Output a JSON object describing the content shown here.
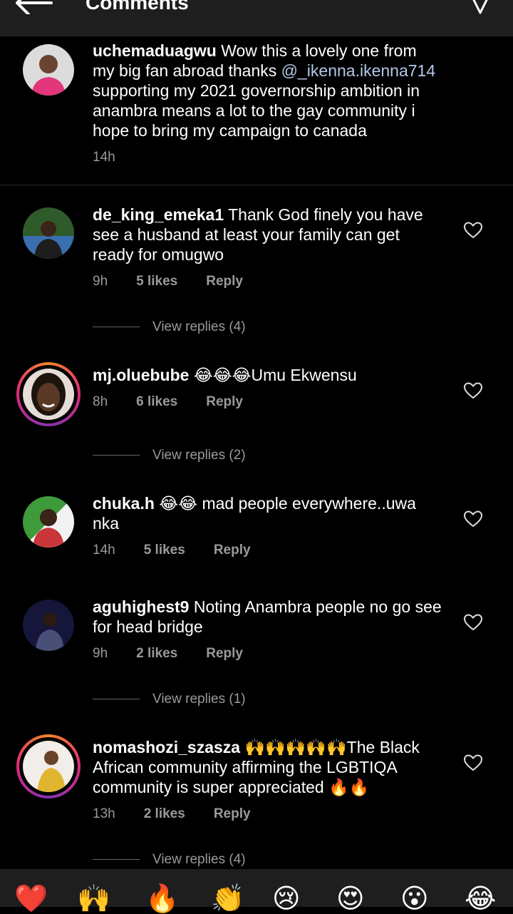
{
  "header": {
    "title": "Comments",
    "back_icon": "back-arrow-icon",
    "send_icon": "send-icon"
  },
  "caption": {
    "username": "uchemaduagwu",
    "text_before": " Wow this a lovely one from my big fan abroad thanks ",
    "mention": "@_ikenna.ikenna714",
    "text_after": " supporting my 2021 governorship ambition in anambra means a lot to the gay community i hope to bring my campaign to canada",
    "time": "14h"
  },
  "comments": [
    {
      "username": "de_king_emeka1",
      "text": " Thank God finely you have see a husband at least your family can get ready for omugwo",
      "time": "9h",
      "likes": "5 likes",
      "reply": "Reply",
      "view_replies": "View replies (4)"
    },
    {
      "username": "mj.oluebube",
      "text": " 😂😂😂Umu Ekwensu",
      "time": "8h",
      "likes": "6 likes",
      "reply": "Reply",
      "view_replies": "View replies (2)"
    },
    {
      "username": "chuka.h",
      "text": " 😂😂 mad people everywhere..uwa nka",
      "time": "14h",
      "likes": "5 likes",
      "reply": "Reply"
    },
    {
      "username": "aguhighest9",
      "text": " Noting Anambra people no go see for head bridge",
      "time": "9h",
      "likes": "2 likes",
      "reply": "Reply",
      "view_replies": "View replies (1)"
    },
    {
      "username": "nomashozi_szasza",
      "text": " 🙌🙌🙌🙌🙌The Black African community affirming the LGBTIQA community is super appreciated 🔥🔥",
      "time": "13h",
      "likes": "2 likes",
      "reply": "Reply",
      "view_replies": "View replies (4)"
    }
  ],
  "emoji_bar": [
    "❤️",
    "🙌",
    "🔥",
    "👏",
    "😢",
    "😍",
    "😮",
    "😂"
  ]
}
